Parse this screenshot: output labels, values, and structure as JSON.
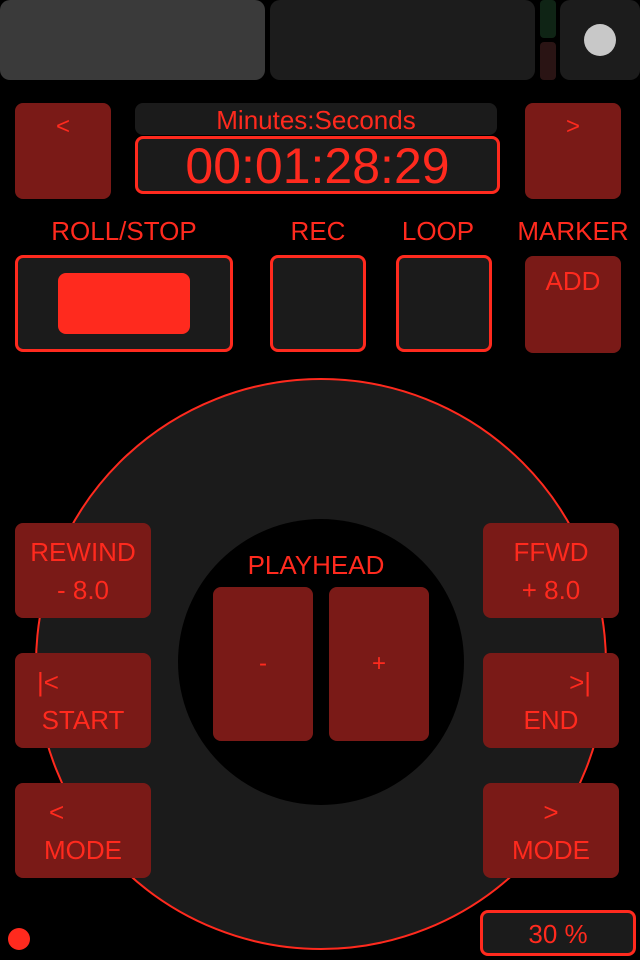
{
  "transport": {
    "prev_label": "<",
    "next_label": ">",
    "time_mode": "Minutes:Seconds",
    "timecode": "00:01:28:29"
  },
  "labels": {
    "roll_stop": "ROLL/STOP",
    "rec": "REC",
    "loop": "LOOP",
    "marker": "MARKER"
  },
  "marker_add": "ADD",
  "wheel": {
    "playhead_label": "PLAYHEAD",
    "minus": "-",
    "plus": "+"
  },
  "left_buttons": [
    {
      "line1": "REWIND",
      "line2": "- 8.0"
    },
    {
      "line1": "|<",
      "line2": "START"
    },
    {
      "line1": "<",
      "line2": "MODE"
    }
  ],
  "right_buttons": [
    {
      "line1": "FFWD",
      "line2": "+ 8.0"
    },
    {
      "line1": ">|",
      "line2": "END"
    },
    {
      "line1": ">",
      "line2": "MODE"
    }
  ],
  "zoom_percent": "30 %",
  "colors": {
    "accent": "#ff2a1e",
    "button_fill": "#7a1a17",
    "panel": "#1b1b1b",
    "background": "#000000"
  }
}
